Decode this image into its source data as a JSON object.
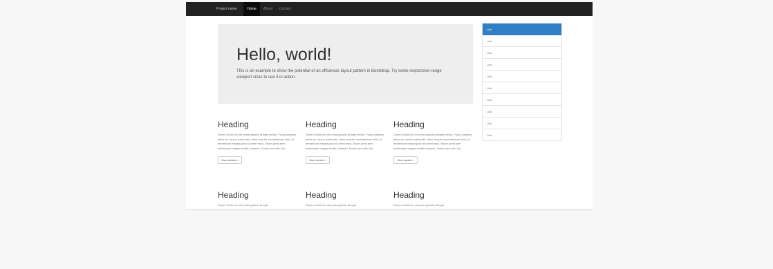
{
  "navbar": {
    "brand": "Project name",
    "items": [
      "Home",
      "About",
      "Contact"
    ],
    "active_index": 0
  },
  "jumbotron": {
    "title": "Hello, world!",
    "text": "This is an example to show the potential of an offcanvas layout pattern in Bootstrap. Try some responsive-range viewport sizes to see it in action."
  },
  "columns": [
    {
      "heading": "Heading",
      "text": "Donec id elit non mi porta gravida at eget metus. Fusce dapibus, tellus ac cursus commodo, tortor mauris condimentum nibh, ut fermentum massa justo sit amet risus. Etiam porta sem malesuada magna mollis euismod. Donec sed odio dui.",
      "button": "View details »"
    },
    {
      "heading": "Heading",
      "text": "Donec id elit non mi porta gravida at eget metus. Fusce dapibus, tellus ac cursus commodo, tortor mauris condimentum nibh, ut fermentum massa justo sit amet risus. Etiam porta sem malesuada magna mollis euismod. Donec sed odio dui.",
      "button": "View details »"
    },
    {
      "heading": "Heading",
      "text": "Donec id elit non mi porta gravida at eget metus. Fusce dapibus, tellus ac cursus commodo, tortor mauris condimentum nibh, ut fermentum massa justo sit amet risus. Etiam porta sem malesuada magna mollis euismod. Donec sed odio dui.",
      "button": "View details »"
    },
    {
      "heading": "Heading",
      "text": "Donec id elit non mi porta gravida at eget"
    },
    {
      "heading": "Heading",
      "text": "Donec id elit non mi porta gravida at eget"
    },
    {
      "heading": "Heading",
      "text": "Donec id elit non mi porta gravida at eget"
    }
  ],
  "sidebar": {
    "links": [
      "Link",
      "Link",
      "Link",
      "Link",
      "Link",
      "Link",
      "Link",
      "Link",
      "Link",
      "Link"
    ],
    "active_index": 0
  },
  "colors": {
    "navbar_bg": "#222222",
    "accent": "#2f7fc7",
    "jumbotron_bg": "#eeeeee"
  }
}
